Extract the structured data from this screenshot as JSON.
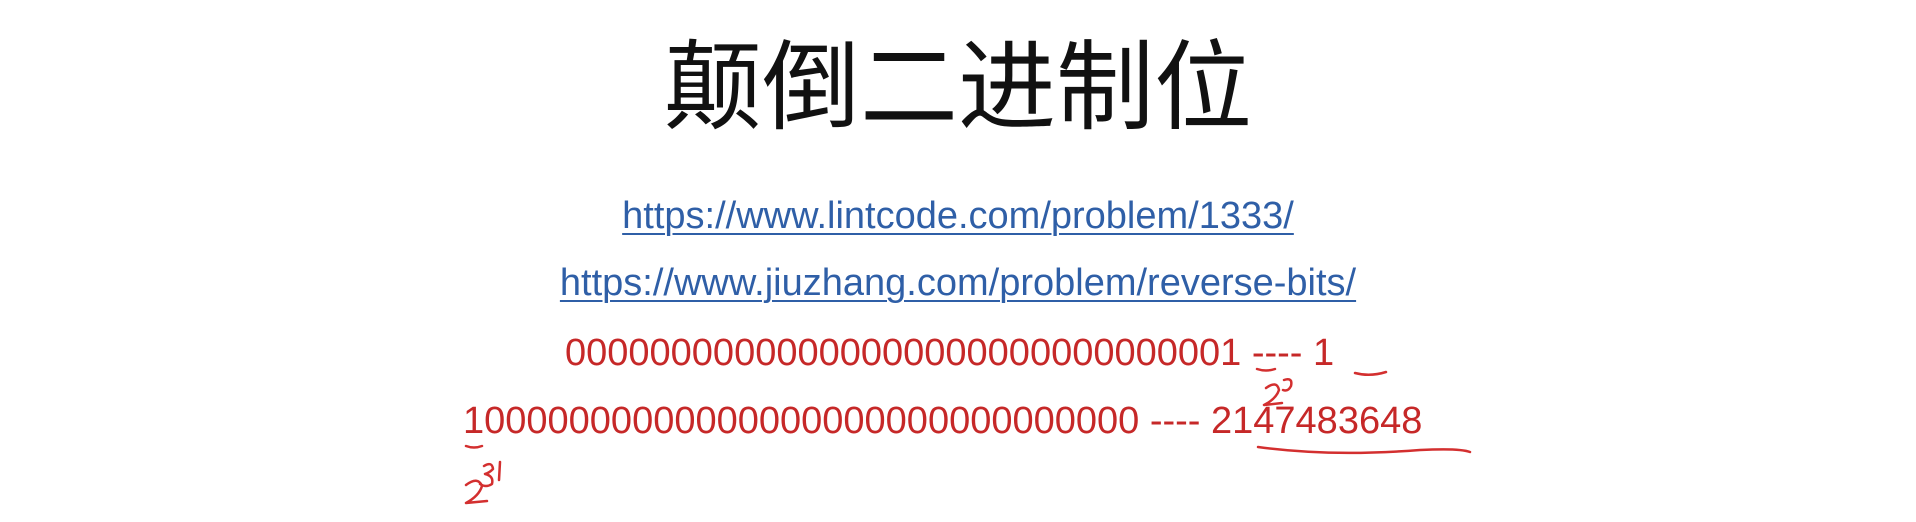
{
  "slide": {
    "title": "颠倒二进制位",
    "links": [
      "https://www.lintcode.com/problem/1333/",
      "https://www.jiuzhang.com/problem/reverse-bits/"
    ],
    "rows": [
      {
        "bits": "00000000000000000000000000000001",
        "separator": " ---- ",
        "value": "1"
      },
      {
        "bits": "10000000000000000000000000000000",
        "separator": " ---- ",
        "value": "2147483648"
      }
    ]
  },
  "colors": {
    "title": "#111111",
    "link": "#2f5fa7",
    "red_text": "#c62828",
    "handwriting": "#d32f2f"
  }
}
